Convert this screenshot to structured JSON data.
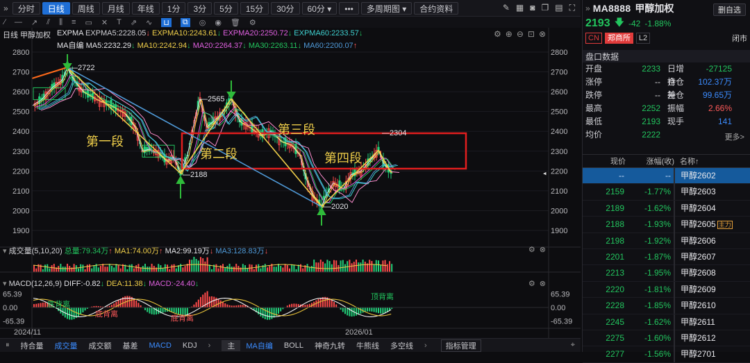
{
  "toolbar": {
    "periods": [
      "分时",
      "日线",
      "周线",
      "月线",
      "年线",
      "1分",
      "3分",
      "5分",
      "15分",
      "30分",
      "60分 ▾",
      "•••",
      "多周期图 ▾",
      "合约资料"
    ],
    "active_period": "日线"
  },
  "chart_title": "日线 甲醇加权",
  "legend": {
    "expma_name": "EXPMA",
    "expma5": "EXPMA5:2228.05",
    "expma10": "EXPMA10:2243.61",
    "expma20": "EXPMA20:2250.72",
    "expma60": "EXPMA60:2233.57",
    "ma_name": "MA自编",
    "ma5": "MA5:2232.29",
    "ma10": "MA10:2242.94",
    "ma20": "MA20:2264.37",
    "ma30": "MA30:2263.11",
    "ma60": "MA60:2200.07",
    "vol_name": "成交量(5,10,20)",
    "vol_total": "总量:79.34万",
    "vol_ma1": "MA1:74.00万",
    "vol_ma2": "MA2:99.19万",
    "vol_ma3": "MA3:128.83万",
    "macd_name": "MACD(12,26,9)",
    "diff": "DIFF:-0.82",
    "dea": "DEA:11.38",
    "macd": "MACD:-24.40"
  },
  "annotations": {
    "seg1": "第一段",
    "seg2": "第二段",
    "seg3": "第三段",
    "seg4": "第四段",
    "p2722": "2722",
    "p2565": "2565",
    "p2188": "2188",
    "p2020": "2020",
    "p2304": "2304",
    "top_div": "顶背离",
    "bot_div1": "底背离",
    "bot_div2": "底背离",
    "top_div2": "顶背离"
  },
  "axis": {
    "price_ticks": [
      "2800",
      "2700",
      "2600",
      "2500",
      "2400",
      "2300",
      "2200",
      "2100",
      "2000",
      "1900"
    ],
    "macd_ticks": [
      "65.39",
      "0.00",
      "-65.39"
    ],
    "dates": [
      "2024/11",
      "2026/01"
    ]
  },
  "chart_data": {
    "type": "line",
    "title": "甲醇加权",
    "x": [
      "2024/11",
      "2026/01"
    ],
    "ylim": [
      1900,
      2800
    ],
    "series": [
      {
        "name": "甲醇加权",
        "values": [
          2722,
          2188,
          2565,
          2020,
          2304,
          2193
        ]
      }
    ]
  },
  "bottom_tabs": [
    "持合量",
    "成交量",
    "成交额",
    "基差",
    "MACD",
    "KDJ"
  ],
  "bottom_tabs2": [
    "主",
    "MA自编",
    "BOLL",
    "神奇九转",
    "牛熊线",
    "多空线"
  ],
  "indicator_mgmt": "指标管理",
  "right": {
    "symbol": "MA8888",
    "name": "甲醇加权",
    "add": "删自选",
    "price": "2193",
    "change": "-42",
    "pct": "-1.88%",
    "tags": [
      "CN",
      "郑商所",
      "L2"
    ],
    "status": "闭市",
    "section": "盘口数据",
    "quote": [
      [
        "开盘",
        "2233",
        "日增仓",
        "-27125"
      ],
      [
        "涨停",
        "--",
        "持仓差",
        "102.37万"
      ],
      [
        "跌停",
        "--",
        "持仓",
        "99.65万"
      ],
      [
        "最高",
        "2252",
        "振幅",
        "2.66%"
      ],
      [
        "最低",
        "2193",
        "现手",
        "141"
      ],
      [
        "均价",
        "2222",
        "",
        ""
      ]
    ],
    "more": "更多>",
    "list_head": [
      "现价",
      "涨幅(收)",
      "名称↑"
    ],
    "list": [
      [
        "--",
        "--",
        "甲醇2602"
      ],
      [
        "2159",
        "-1.77%",
        "甲醇2603"
      ],
      [
        "2189",
        "-1.62%",
        "甲醇2604"
      ],
      [
        "2188",
        "-1.93%",
        "甲醇2605"
      ],
      [
        "2198",
        "-1.92%",
        "甲醇2606"
      ],
      [
        "2201",
        "-1.87%",
        "甲醇2607"
      ],
      [
        "2213",
        "-1.95%",
        "甲醇2608"
      ],
      [
        "2220",
        "-1.81%",
        "甲醇2609"
      ],
      [
        "2228",
        "-1.85%",
        "甲醇2610"
      ],
      [
        "2245",
        "-1.62%",
        "甲醇2611"
      ],
      [
        "2275",
        "-1.60%",
        "甲醇2612"
      ],
      [
        "2277",
        "-1.56%",
        "甲醇2701"
      ]
    ],
    "main_badge": "主力"
  }
}
